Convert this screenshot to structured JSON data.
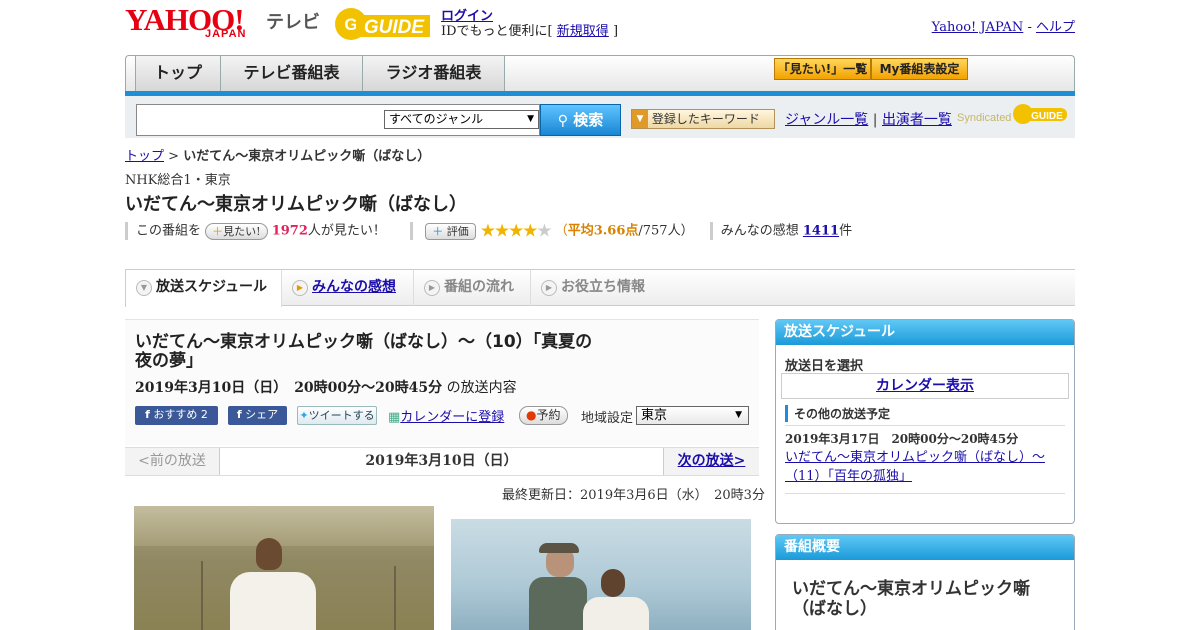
{
  "header": {
    "logo_text": "YAHOO!",
    "logo_sub": "JAPAN",
    "service": "テレビ",
    "guide_logo": "GUIDE",
    "login": "ログイン",
    "id_prefix": "IDでもっと便利に[",
    "signup": "新規取得",
    "id_suffix": "]",
    "yahoo_japan": "Yahoo! JAPAN",
    "dash": "-",
    "help": "ヘルプ"
  },
  "nav": {
    "tabs": [
      "トップ",
      "テレビ番組表",
      "ラジオ番組表"
    ],
    "want_list": "「見たい!」一覧",
    "my_settings": "My番組表設定"
  },
  "search": {
    "genre_select": "すべてのジャンル",
    "button": "検索",
    "registered_keyword": "登録したキーワード",
    "genre_list": "ジャンル一覧",
    "divider": "|",
    "performer_list": "出演者一覧",
    "syndicated": "Syndicated"
  },
  "breadcrumb": {
    "top": "トップ",
    "sep": ">",
    "current": "いだてん～東京オリムピック噺（ばなし）"
  },
  "program": {
    "channel": "NHK総合1・東京",
    "title": "いだてん～東京オリムピック噺（ばなし）",
    "want_prefix": "この番組を",
    "want_button": "見たい!",
    "want_count": "1972",
    "want_suffix": "人が見たい！",
    "rate_button": "評価",
    "rating_paren_open": "（",
    "rating_avg": "平均3.66点",
    "rating_votes": "/757人）",
    "rating_value": 3.66,
    "impressions_label": "みんなの感想",
    "impressions_count": "1411",
    "impressions_suffix": "件"
  },
  "subtabs": [
    "放送スケジュール",
    "みんなの感想",
    "番組の流れ",
    "お役立ち情報"
  ],
  "episode": {
    "title": "いだてん～東京オリムピック噺（ばなし）～（10）「真夏の夜の夢」",
    "datetime": "2019年3月10日（日）　20時00分～20時45分",
    "datetime_suffix": "の放送内容",
    "recommend": "おすすめ 2",
    "share": "シェア",
    "tweet": "ツイートする",
    "calendar": "カレンダーに登録",
    "reserve": "予約",
    "region_label": "地域設定",
    "region_value": "東京",
    "prev": "<前の放送",
    "current_date": "2019年3月10日（日）",
    "next": "次の放送>",
    "updated": "最終更新日：2019年3月6日（水）　20時3分"
  },
  "sidebar": {
    "schedule_title": "放送スケジュール",
    "select_date": "放送日を選択",
    "calendar_view": "カレンダー表示",
    "other_title": "その他の放送予定",
    "other_datetime": "2019年3月17日　20時00分～20時45分",
    "other_link": "いだてん～東京オリムピック噺（ばなし）～（11）「百年の孤独」",
    "summary_title": "番組概要",
    "summary_program": "いだてん～東京オリムピック噺（ばなし）"
  },
  "colors": {
    "accent_blue": "#1e8fd6",
    "brand_red": "#e60012",
    "orange": "#f3a200",
    "want_count": "#e0245e",
    "rating": "#d98200"
  }
}
